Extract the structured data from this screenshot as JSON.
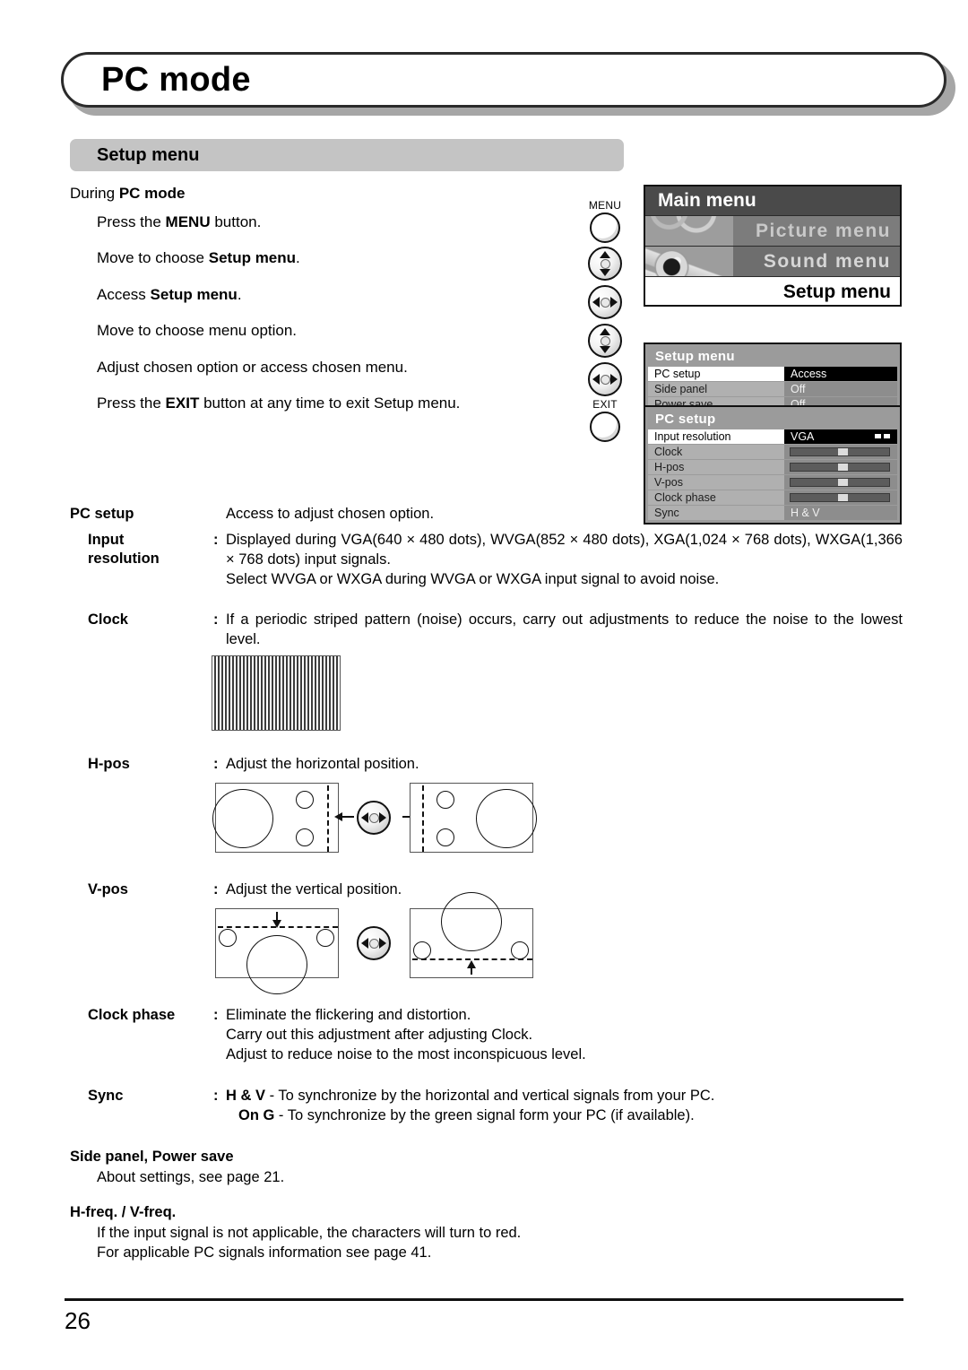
{
  "page": {
    "title": "PC mode",
    "section_title": "Setup menu",
    "page_number": "26"
  },
  "intro": {
    "lead_prefix": "During ",
    "lead_bold": "PC mode",
    "steps": [
      {
        "pre": "Press the ",
        "bold": "MENU",
        "post": " button."
      },
      {
        "pre": "Move to choose ",
        "bold": "Setup menu",
        "post": "."
      },
      {
        "pre": "Access ",
        "bold": "Setup menu",
        "post": "."
      },
      {
        "pre": "Move to choose menu option.",
        "bold": "",
        "post": ""
      },
      {
        "pre": "Adjust chosen option or access chosen menu.",
        "bold": "",
        "post": ""
      },
      {
        "pre": "Press the ",
        "bold": "EXIT",
        "post": " button at any time to exit Setup menu."
      }
    ]
  },
  "remote_buttons": [
    {
      "caption": "MENU",
      "icon": "round-button-icon",
      "type": "plain"
    },
    {
      "caption": "",
      "icon": "up-down-arrows-icon",
      "type": "vertical"
    },
    {
      "caption": "",
      "icon": "left-right-arrows-icon",
      "type": "horizontal"
    },
    {
      "caption": "",
      "icon": "up-down-arrows-icon",
      "type": "vertical"
    },
    {
      "caption": "",
      "icon": "left-right-arrows-icon",
      "type": "horizontal"
    },
    {
      "caption": "EXIT",
      "icon": "round-button-icon",
      "type": "plain"
    }
  ],
  "osd": {
    "main_menu": {
      "title": "Main menu",
      "items": [
        "Picture menu",
        "Sound menu",
        "Setup menu"
      ],
      "selected": "Setup menu"
    },
    "setup_menu": {
      "title": "Setup menu",
      "rows": [
        {
          "label": "PC setup",
          "value": "Access",
          "selected": true
        },
        {
          "label": "Side panel",
          "value": "Off",
          "selected": false
        },
        {
          "label": "Power save",
          "value": "Off",
          "selected": false
        }
      ]
    },
    "pc_setup": {
      "title": "PC setup",
      "rows": [
        {
          "label": "Input resolution",
          "value": "VGA",
          "selected": true,
          "kind": "value-arrows"
        },
        {
          "label": "Clock",
          "value": "",
          "selected": false,
          "kind": "slider"
        },
        {
          "label": "H-pos",
          "value": "",
          "selected": false,
          "kind": "slider"
        },
        {
          "label": "V-pos",
          "value": "",
          "selected": false,
          "kind": "slider"
        },
        {
          "label": "Clock phase",
          "value": "",
          "selected": false,
          "kind": "slider"
        },
        {
          "label": "Sync",
          "value": "H & V",
          "selected": false,
          "kind": "text"
        }
      ]
    }
  },
  "definitions": {
    "pc_setup": {
      "term": "PC setup",
      "colon": "",
      "lines": [
        "Access to adjust chosen option."
      ]
    },
    "input_resolution": {
      "term_line1": "Input",
      "term_line2": "resolution",
      "colon": ":",
      "lines": [
        "Displayed during VGA(640 × 480 dots), WVGA(852 × 480 dots), XGA(1,024 × 768 dots), WXGA(1,366 × 768 dots) input signals.",
        "Select WVGA or WXGA during WVGA or WXGA input signal to avoid noise."
      ]
    },
    "clock": {
      "term": "Clock",
      "colon": ":",
      "lines": [
        "If a periodic striped pattern (noise) occurs, carry out adjustments to reduce the noise to the lowest level."
      ]
    },
    "h_pos": {
      "term": "H-pos",
      "colon": ":",
      "lines": [
        "Adjust the horizontal position."
      ]
    },
    "v_pos": {
      "term": "V-pos",
      "colon": ":",
      "lines": [
        "Adjust the vertical position."
      ]
    },
    "clock_phase": {
      "term": "Clock phase",
      "colon": ":",
      "lines": [
        "Eliminate the flickering and distortion.",
        "Carry out this adjustment after adjusting Clock.",
        "Adjust to reduce noise to the most inconspicuous level."
      ]
    },
    "sync": {
      "term": "Sync",
      "colon": ":",
      "line1_bold": "H & V",
      "line1_rest": " - To synchronize by the horizontal and vertical signals from your PC.",
      "line2_bold": "On G",
      "line2_rest": " - To synchronize by the green signal form your PC (if available)."
    },
    "side_panel": {
      "heading": "Side panel, Power save",
      "lines": [
        "About settings, see page 21."
      ]
    },
    "h_freq": {
      "heading": "H-freq. / V-freq.",
      "lines": [
        "If the input signal is not applicable, the characters will turn to red.",
        "For applicable PC signals information see page 41."
      ]
    }
  }
}
